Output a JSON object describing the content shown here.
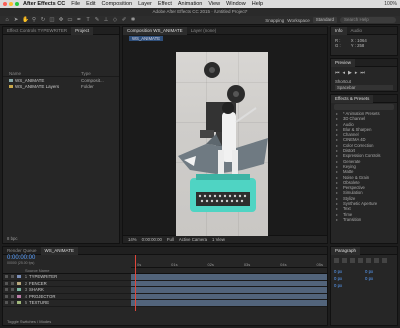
{
  "menubar": {
    "app": "After Effects CC",
    "items": [
      "File",
      "Edit",
      "Composition",
      "Layer",
      "Effect",
      "Animation",
      "View",
      "Window",
      "Help"
    ],
    "clock": "100%"
  },
  "titlebar": "Adobe After Effects CC 2015 · /Untitled Project*",
  "toolbar": {
    "snapping": "Snapping",
    "workspace": "Workspace",
    "workspace_value": "Standard",
    "search_placeholder": "Search Help"
  },
  "project": {
    "tabs": [
      "Effect Controls TYPEWRITER",
      "Project"
    ],
    "columns": {
      "name": "Name",
      "type": "Type"
    },
    "rows": [
      {
        "name": "WS_ANIMATE",
        "type": "Composit..."
      },
      {
        "name": "WS_ANIMATE Layers",
        "type": "Folder"
      }
    ],
    "footer": "8 bpc"
  },
  "composition": {
    "tab": "Composition WS_ANIMATE",
    "tab2": "Layer (none)",
    "breadcrumb": "WS_ANIMATE",
    "zoom": "14%",
    "timecode": "0:00:00:00",
    "resolution": "Full",
    "camera": "Active Camera",
    "view": "1 View"
  },
  "info": {
    "tabs": [
      "Info",
      "Audio"
    ],
    "r": "R :",
    "g": "G :",
    "x": "X : 1064",
    "y": "Y : 258"
  },
  "preview": {
    "title": "Preview",
    "shortcut_label": "Shortcut",
    "shortcut_value": "Spacebar"
  },
  "effects": {
    "title": "Effects & Presets",
    "search_placeholder": "",
    "items": [
      "* Animation Presets",
      "3D Channel",
      "Audio",
      "Blur & Sharpen",
      "Channel",
      "CINEMA 4D",
      "Color Correction",
      "Distort",
      "Expression Controls",
      "Generate",
      "Keying",
      "Matte",
      "Noise & Grain",
      "Obsolete",
      "Perspective",
      "Simulation",
      "Stylize",
      "Synthetic Aperture",
      "Text",
      "Time",
      "Transition"
    ]
  },
  "timeline": {
    "tabs": [
      "Render Queue",
      "WS_ANIMATE"
    ],
    "timecode": "0:00:00:00",
    "fps": "00000 (25.00 fps)",
    "header": "Source Name",
    "layers": [
      {
        "num": "1",
        "name": "TYPEWRITER",
        "color": "#7c8fb8"
      },
      {
        "num": "2",
        "name": "FENCER",
        "color": "#b8a77c"
      },
      {
        "num": "3",
        "name": "SHARK",
        "color": "#7cb8a2"
      },
      {
        "num": "4",
        "name": "PROJECTOR",
        "color": "#b87ca6"
      },
      {
        "num": "5",
        "name": "TEXTURE",
        "color": "#a0b87c"
      }
    ],
    "ruler": [
      "0s",
      "01s",
      "02s",
      "03s",
      "04s",
      "05s"
    ],
    "footer": "Toggle Switches / Modes"
  },
  "paragraph": {
    "title": "Paragraph",
    "fields": [
      "0 px",
      "0 px",
      "0 px",
      "0 px",
      "0 px"
    ]
  }
}
